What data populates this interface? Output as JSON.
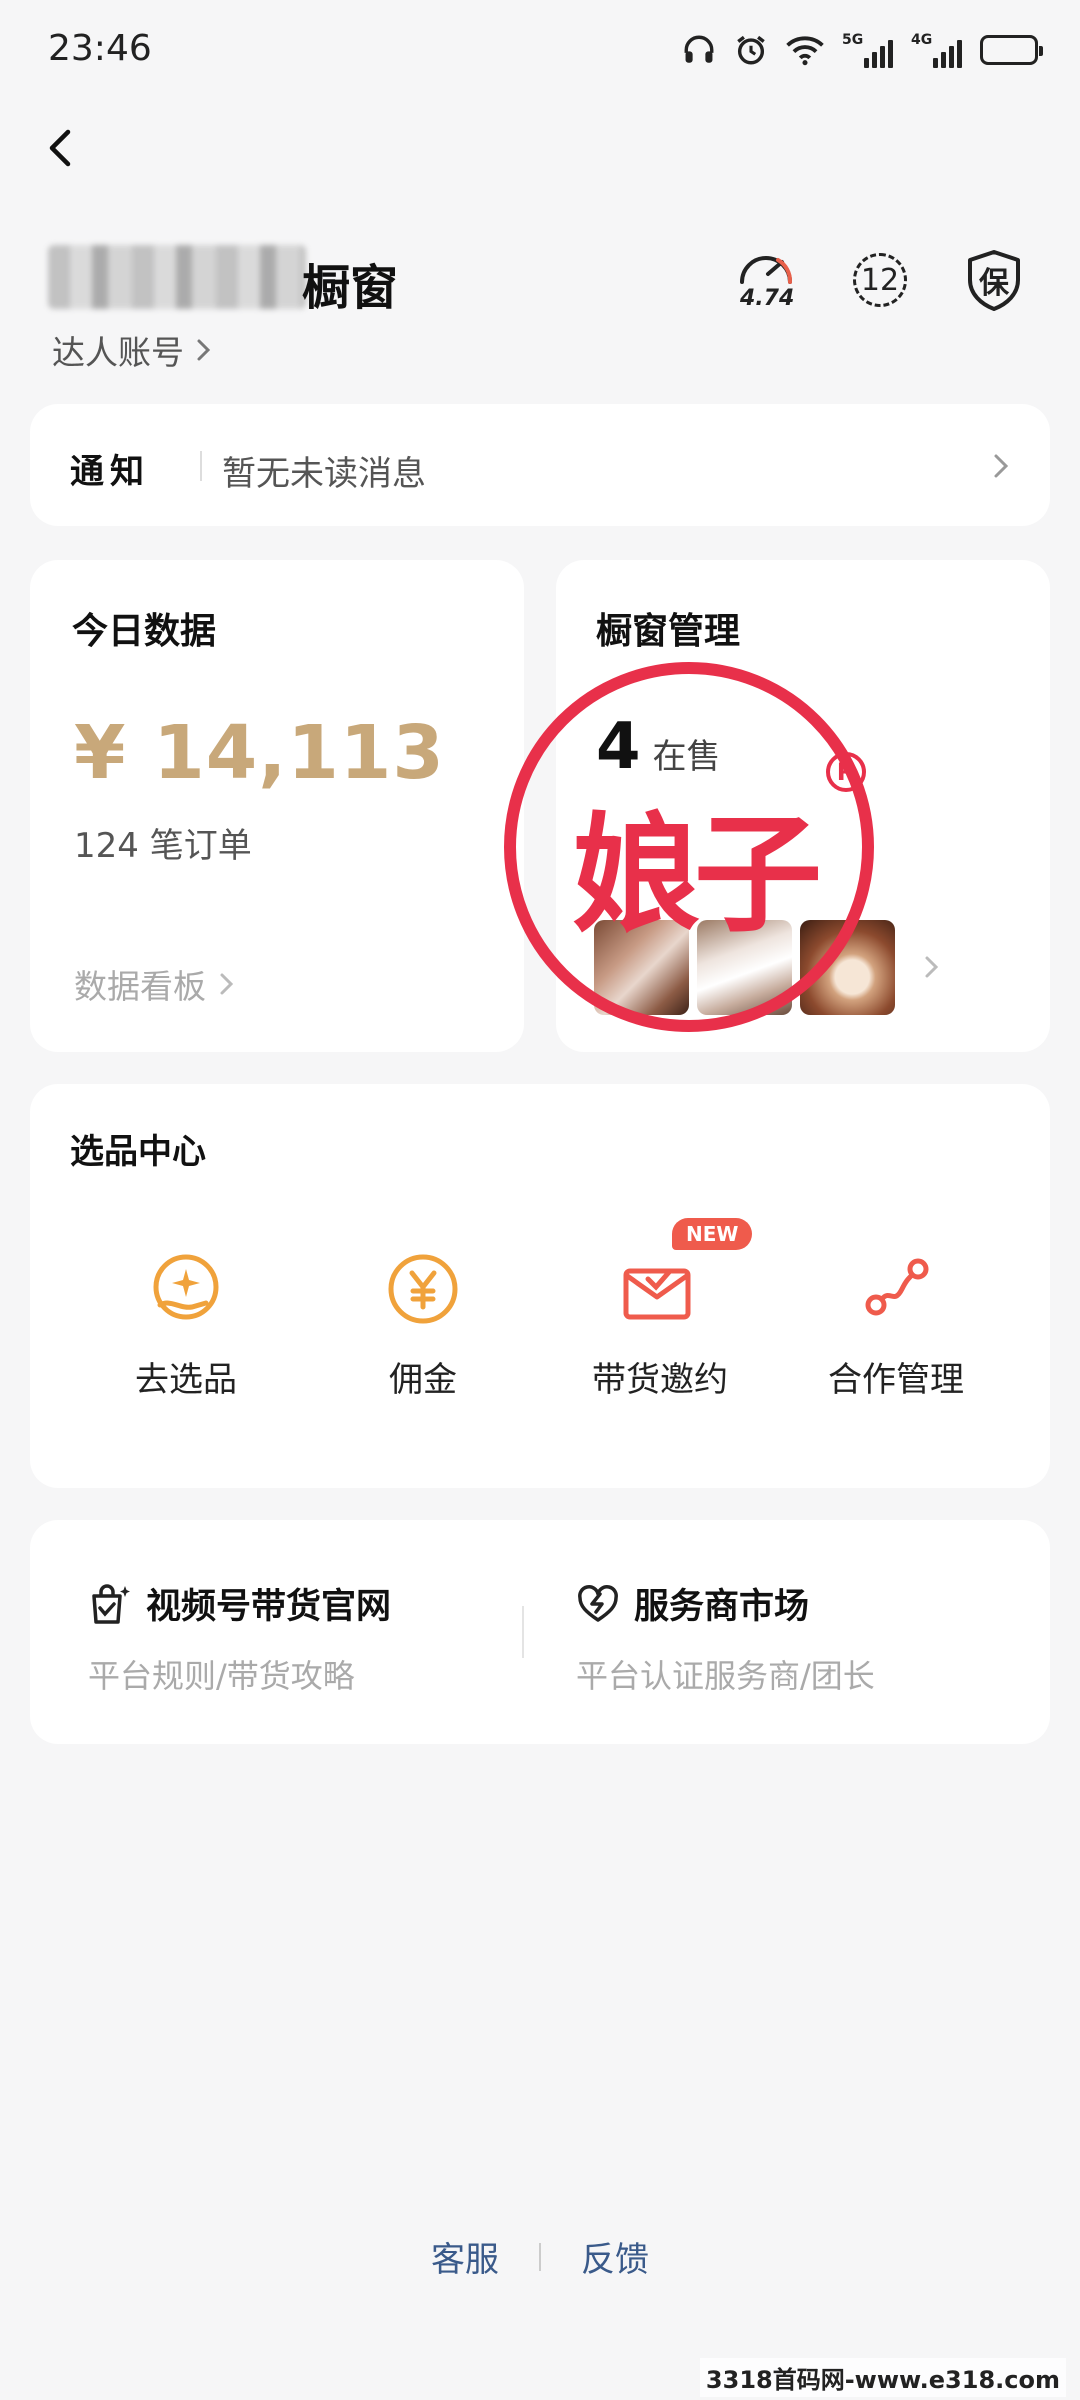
{
  "status_bar": {
    "time": "23:46",
    "net1": "5G",
    "net2": "4G"
  },
  "header": {
    "title_suffix": "橱窗",
    "account_label": "达人账号",
    "score": "4.74",
    "level": "12",
    "guarantee_label": "保"
  },
  "notice": {
    "label": "通知",
    "text": "暂无未读消息"
  },
  "today": {
    "title": "今日数据",
    "amount": "¥ 14,113",
    "orders": "124 笔订单",
    "dashboard_link": "数据看板"
  },
  "window": {
    "title": "橱窗管理",
    "on_sale_count": "4",
    "on_sale_label": "在售"
  },
  "watermark": {
    "text": "娘子",
    "reg": "R"
  },
  "select_center": {
    "title": "选品中心",
    "items": [
      {
        "label": "去选品",
        "icon": "hand-star-icon"
      },
      {
        "label": "佣金",
        "icon": "yuan-coin-icon"
      },
      {
        "label": "带货邀约",
        "icon": "invite-envelope-icon",
        "badge": "NEW"
      },
      {
        "label": "合作管理",
        "icon": "cooperation-path-icon"
      }
    ]
  },
  "links": {
    "official": {
      "title": "视频号带货官网",
      "subtitle": "平台规则/带货攻略"
    },
    "market": {
      "title": "服务商市场",
      "subtitle": "平台认证服务商/团长"
    }
  },
  "footer": {
    "service": "客服",
    "feedback": "反馈"
  },
  "site_mark": "3318首码网-www.e318.com",
  "colors": {
    "amount": "#c8a87a",
    "accent_orange": "#f0a23b",
    "accent_red": "#ef5b4c",
    "footer_link": "#3a5a8a"
  }
}
